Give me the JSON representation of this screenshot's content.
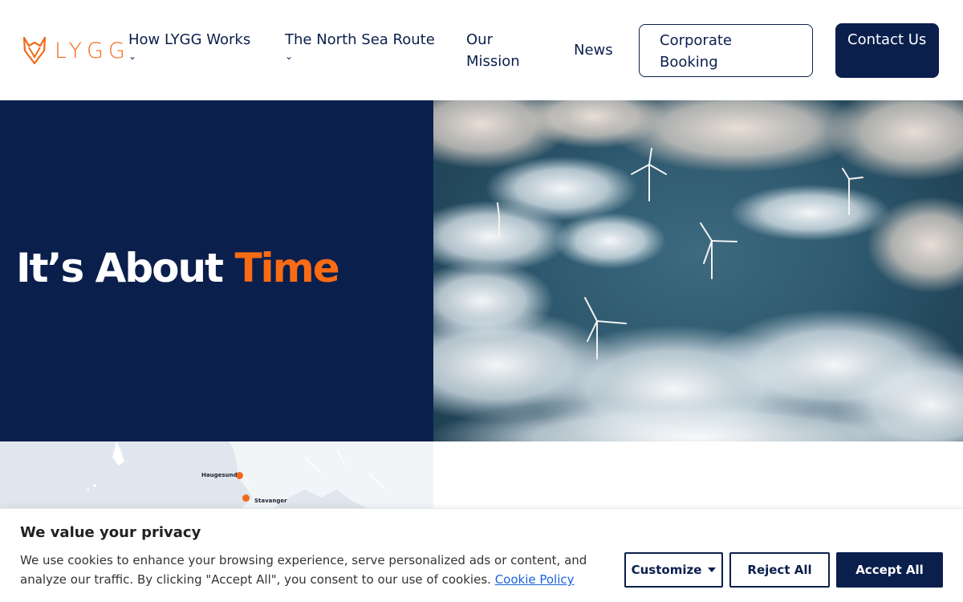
{
  "header": {
    "logo_text": "LYGG",
    "nav": [
      {
        "label": "How LYGG Works",
        "has_dropdown": true
      },
      {
        "label": "The North Sea Route",
        "has_dropdown": true
      },
      {
        "label": "Our Mission",
        "has_dropdown": false
      },
      {
        "label": "News",
        "has_dropdown": false
      }
    ],
    "chevron": "⌄",
    "corporate_booking": "Corporate Booking",
    "contact": "Contact Us"
  },
  "hero": {
    "title_main": "It’s About",
    "title_accent": "Time"
  },
  "map": {
    "labels": [
      "Haugesund",
      "Stavanger"
    ]
  },
  "cookie": {
    "title": "We value your privacy",
    "text": "We use cookies to enhance your browsing experience, serve personalized ads or content, and analyze our traffic. By clicking \"Accept All\", you consent to our use of cookies.",
    "link": "Cookie Policy",
    "customize": "Customize",
    "reject": "Reject All",
    "accept": "Accept All"
  },
  "colors": {
    "navy": "#0b1f4d",
    "orange": "#f96b14",
    "link": "#1863dc"
  }
}
